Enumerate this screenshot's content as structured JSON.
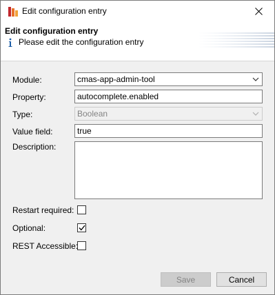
{
  "window": {
    "title": "Edit configuration entry",
    "app_icon": "app-logo-icon",
    "close_icon": "close-icon"
  },
  "header": {
    "title": "Edit configuration entry",
    "info_icon": "info-icon",
    "message": "Please edit the configuration entry"
  },
  "form": {
    "module": {
      "label": "Module:",
      "value": "cmas-app-admin-tool"
    },
    "property": {
      "label": "Property:",
      "value": "autocomplete.enabled"
    },
    "type": {
      "label": "Type:",
      "value": "Boolean",
      "disabled": true
    },
    "value_field": {
      "label": "Value field:",
      "value": "true"
    },
    "description": {
      "label": "Description:",
      "value": ""
    },
    "restart_required": {
      "label": "Restart required:",
      "checked": false
    },
    "optional": {
      "label": "Optional:",
      "checked": true
    },
    "rest_accessible": {
      "label": "REST Accessible:",
      "checked": false
    }
  },
  "buttons": {
    "save_label": "Save",
    "save_enabled": false,
    "cancel_label": "Cancel"
  },
  "colors": {
    "window_bg": "#f0f0f0",
    "header_bg": "#ffffff",
    "border": "#7a7a7a",
    "disabled_text": "#838383",
    "info_blue": "#1f5fa8",
    "icon_orange": "#e8712a",
    "icon_red": "#c1272d"
  }
}
